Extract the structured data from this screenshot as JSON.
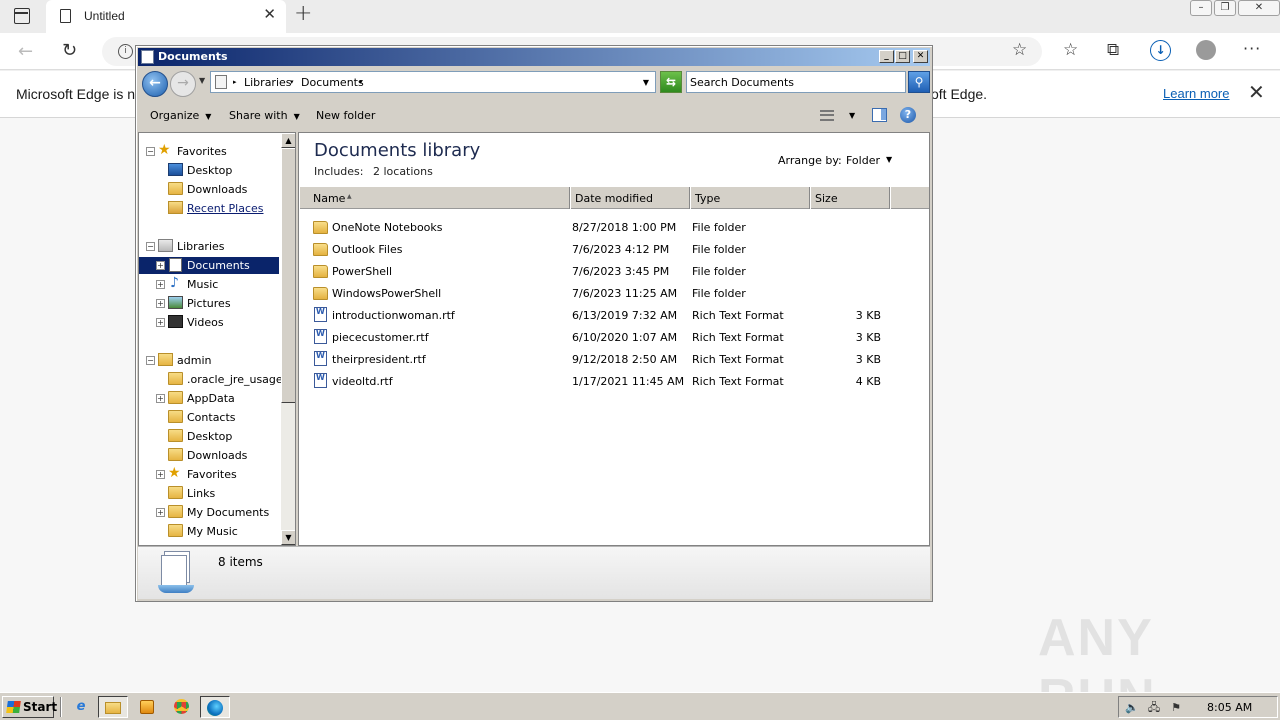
{
  "browser": {
    "tab_title": "Untitled",
    "infobar_left": "Microsoft Edge is no",
    "infobar_right": "oft Edge.",
    "learn_more": "Learn more"
  },
  "explorer": {
    "window_title": "Documents",
    "breadcrumb": [
      "Libraries",
      "Documents"
    ],
    "search_placeholder": "Search Documents",
    "commands": {
      "organize": "Organize",
      "share_with": "Share with",
      "new_folder": "New folder"
    },
    "nav": {
      "favorites": "Favorites",
      "fav_desktop": "Desktop",
      "fav_downloads": "Downloads",
      "fav_recent": "Recent Places",
      "libraries": "Libraries",
      "lib_documents": "Documents",
      "lib_music": "Music",
      "lib_pictures": "Pictures",
      "lib_videos": "Videos",
      "admin": "admin",
      "admin_oracle": ".oracle_jre_usage",
      "admin_appdata": "AppData",
      "admin_contacts": "Contacts",
      "admin_desktop": "Desktop",
      "admin_downloads": "Downloads",
      "admin_favorites": "Favorites",
      "admin_links": "Links",
      "admin_mydocs": "My Documents",
      "admin_mymusic": "My Music"
    },
    "library_title": "Documents library",
    "includes_label": "Includes:",
    "includes_value": "2 locations",
    "arrange_label": "Arrange by:",
    "arrange_value": "Folder",
    "columns": {
      "name": "Name",
      "date": "Date modified",
      "type": "Type",
      "size": "Size"
    },
    "files": [
      {
        "name": "OneNote Notebooks",
        "date": "8/27/2018 1:00 PM",
        "type": "File folder",
        "size": "",
        "kind": "folder"
      },
      {
        "name": "Outlook Files",
        "date": "7/6/2023 4:12 PM",
        "type": "File folder",
        "size": "",
        "kind": "folder"
      },
      {
        "name": "PowerShell",
        "date": "7/6/2023 3:45 PM",
        "type": "File folder",
        "size": "",
        "kind": "folder"
      },
      {
        "name": "WindowsPowerShell",
        "date": "7/6/2023 11:25 AM",
        "type": "File folder",
        "size": "",
        "kind": "folder"
      },
      {
        "name": "introductionwoman.rtf",
        "date": "6/13/2019 7:32 AM",
        "type": "Rich Text Format",
        "size": "3 KB",
        "kind": "rtf"
      },
      {
        "name": "piececustomer.rtf",
        "date": "6/10/2020 1:07 AM",
        "type": "Rich Text Format",
        "size": "3 KB",
        "kind": "rtf"
      },
      {
        "name": "theirpresident.rtf",
        "date": "9/12/2018 2:50 AM",
        "type": "Rich Text Format",
        "size": "3 KB",
        "kind": "rtf"
      },
      {
        "name": "videoltd.rtf",
        "date": "1/17/2021 11:45 AM",
        "type": "Rich Text Format",
        "size": "4 KB",
        "kind": "rtf"
      }
    ],
    "item_count": "8 items"
  },
  "taskbar": {
    "start_label": "Start",
    "clock": "8:05 AM"
  },
  "watermark": "ANY RUN"
}
